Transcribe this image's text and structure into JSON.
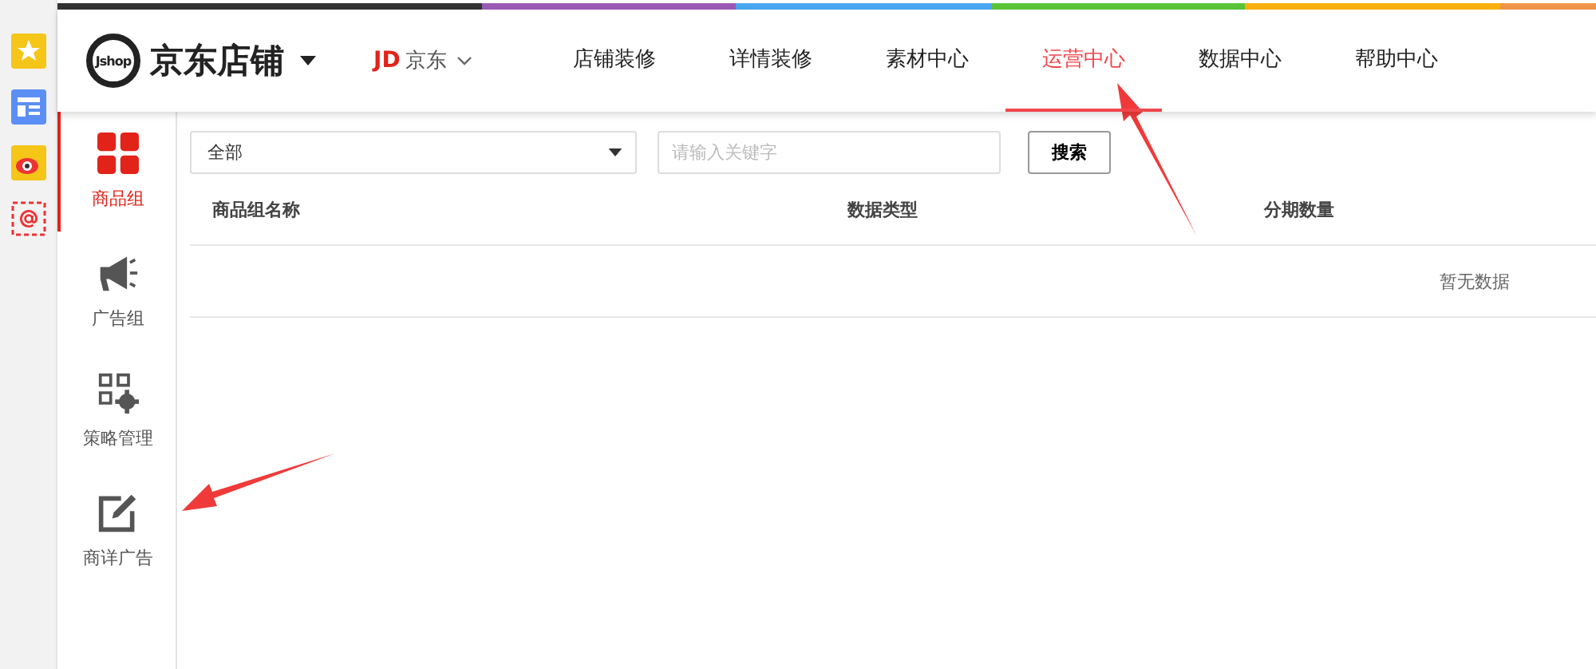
{
  "brand": {
    "logo_text": "Jshop",
    "title": "京东店铺"
  },
  "site": {
    "badge": "JD",
    "name": "京东"
  },
  "nav": [
    {
      "label": "店铺装修",
      "selected": false
    },
    {
      "label": "详情装修",
      "selected": false
    },
    {
      "label": "素材中心",
      "selected": false
    },
    {
      "label": "运营中心",
      "selected": true
    },
    {
      "label": "数据中心",
      "selected": false
    },
    {
      "label": "帮助中心",
      "selected": false
    }
  ],
  "sidebar": [
    {
      "label": "商品组",
      "kind": "grid",
      "selected": true
    },
    {
      "label": "广告组",
      "kind": "megaphone",
      "selected": false
    },
    {
      "label": "策略管理",
      "kind": "settings",
      "selected": false
    },
    {
      "label": "商详广告",
      "kind": "edit",
      "selected": false
    }
  ],
  "filter": {
    "value": "全部"
  },
  "search": {
    "placeholder": "请输入关键字",
    "button": "搜索"
  },
  "table": {
    "columns": [
      "商品组名称",
      "数据类型",
      "分期数量"
    ],
    "empty_text": "暂无数据"
  }
}
